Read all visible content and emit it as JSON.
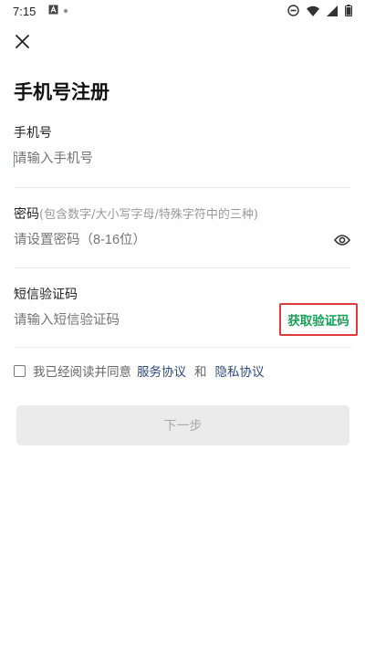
{
  "status_bar": {
    "time": "7:15",
    "left_icons": [
      "notification-a-icon",
      "dot-icon"
    ],
    "right_icons": [
      "do-not-disturb-icon",
      "wifi-icon",
      "signal-icon",
      "battery-icon"
    ]
  },
  "header": {
    "close_icon": "close-icon",
    "title": "手机号注册"
  },
  "form": {
    "phone": {
      "label": "手机号",
      "placeholder": "请输入手机号"
    },
    "password": {
      "label": "密码",
      "hint": "(包含数字/大小写字母/特殊字符中的三种)",
      "placeholder": "请设置密码（8-16位）",
      "visibility_icon": "eye-icon"
    },
    "sms_code": {
      "label": "短信验证码",
      "placeholder": "请输入短信验证码",
      "get_code_label": "获取验证码"
    }
  },
  "agreement": {
    "prefix": "我已经阅读并同意",
    "service_link": "服务协议",
    "conjunction": "和",
    "privacy_link": "隐私协议",
    "checked": false
  },
  "next_button": {
    "label": "下一步",
    "enabled": false
  },
  "colors": {
    "accent_green": "#1aa05a",
    "highlight_red": "#e03b3b",
    "link_blue": "#2e4a7a",
    "disabled_button_bg": "#ebebeb"
  }
}
